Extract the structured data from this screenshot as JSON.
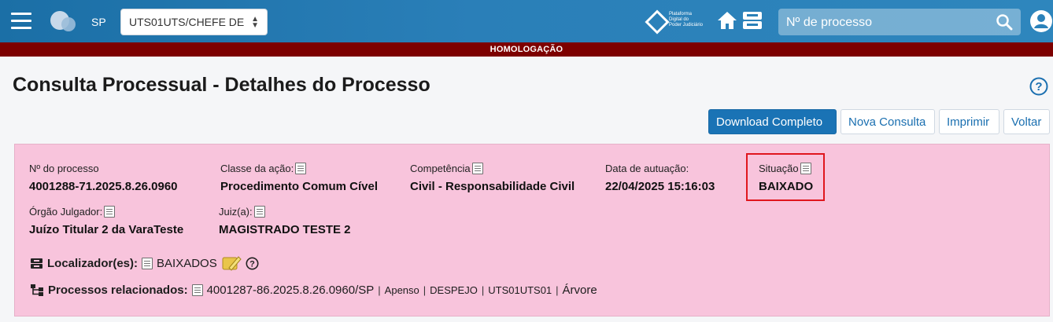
{
  "header": {
    "uf": "SP",
    "org_select": "UTS01UTS/CHEFE DE",
    "pdpj_line1": "Plataforma",
    "pdpj_line2": "Digital do",
    "pdpj_line3": "Poder Judiciário",
    "search_placeholder": "Nº de processo"
  },
  "banner": "HOMOLOGAÇÃO",
  "page": {
    "title": "Consulta Processual - Detalhes do Processo"
  },
  "actions": {
    "download": "Download Completo",
    "nova": "Nova Consulta",
    "imprimir": "Imprimir",
    "voltar": "Voltar"
  },
  "details": {
    "numero_label": "Nº do processo",
    "numero_value": "4001288-71.2025.8.26.0960",
    "classe_label": "Classe da ação:",
    "classe_value": "Procedimento Comum Cível",
    "competencia_label": "Competência",
    "competencia_value": "Civil - Responsabilidade Civil",
    "data_label": "Data de autuação:",
    "data_value": "22/04/2025 15:16:03",
    "situacao_label": "Situação",
    "situacao_value": "BAIXADO",
    "orgao_label": "Órgão Julgador:",
    "orgao_value": "Juízo Titular 2 da VaraTeste",
    "juiz_label": "Juiz(a):",
    "juiz_value": "MAGISTRADO TESTE 2",
    "localizador_label": "Localizador(es):",
    "localizador_value": "BAIXADOS",
    "relacionados_label": "Processos relacionados:",
    "relacionado_numero": "4001287-86.2025.8.26.0960/SP",
    "relacionado_tipo": "Apenso",
    "relacionado_classe": "DESPEJO",
    "relacionado_orgao": "UTS01UTS01",
    "relacionado_arvore": "Árvore",
    "sep": "|"
  }
}
